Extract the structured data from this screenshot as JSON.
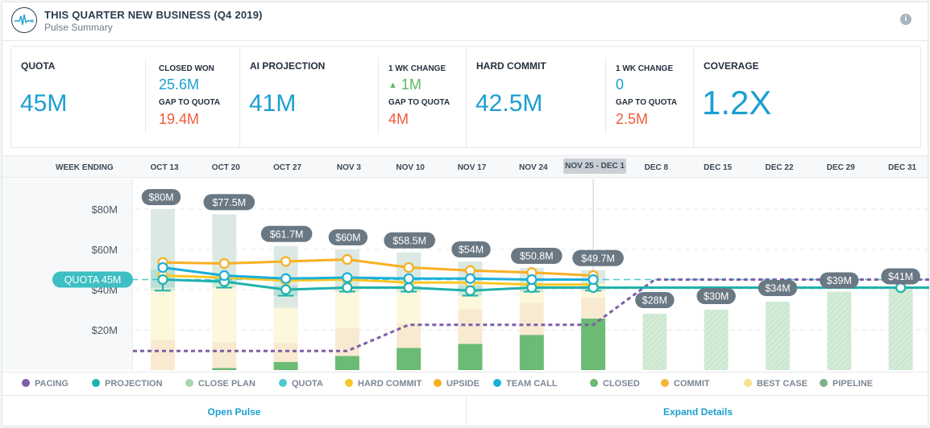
{
  "header": {
    "title": "THIS QUARTER NEW BUSINESS (Q4 2019)",
    "subtitle": "Pulse Summary",
    "logo_icon": "pulse-heartbeat-icon",
    "info_icon": "info-icon",
    "info_glyph": "i"
  },
  "kpis": {
    "quota": {
      "label": "QUOTA",
      "value": "45M"
    },
    "closed_won": {
      "label": "CLOSED WON",
      "value": "25.6M",
      "gap_label": "GAP TO QUOTA",
      "gap_value": "19.4M"
    },
    "ai_projection": {
      "label": "AI PROJECTION",
      "value": "41M"
    },
    "ai_change": {
      "label": "1 WK CHANGE",
      "arrow": "▲",
      "value": "1M",
      "gap_label": "GAP TO QUOTA",
      "gap_value": "4M"
    },
    "hard_commit": {
      "label": "HARD COMMIT",
      "value": "42.5M"
    },
    "hc_change": {
      "label": "1 WK CHANGE",
      "value": "0",
      "gap_label": "GAP TO QUOTA",
      "gap_value": "2.5M"
    },
    "coverage": {
      "label": "COVERAGE",
      "value": "1.2X"
    }
  },
  "weeks": {
    "label": "WEEK ENDING",
    "items": [
      "OCT 13",
      "OCT 20",
      "OCT 27",
      "NOV 3",
      "NOV 10",
      "NOV 17",
      "NOV 24",
      "NOV 25 - DEC 1",
      "DEC 8",
      "DEC 15",
      "DEC 22",
      "DEC 29",
      "DEC 31"
    ],
    "highlighted_index": 7
  },
  "legend": [
    {
      "label": "PACING",
      "color": "#7e5ea8"
    },
    {
      "label": "PROJECTION",
      "color": "#1fb1ad"
    },
    {
      "label": "CLOSE PLAN",
      "color": "#a8d8b0"
    },
    {
      "label": "QUOTA",
      "color": "#4fc9cf"
    },
    {
      "label": "HARD COMMIT",
      "color": "#f9c824"
    },
    {
      "label": "UPSIDE",
      "color": "#f7b023"
    },
    {
      "label": "TEAM CALL",
      "color": "#1ab0da"
    },
    {
      "label": "CLOSED",
      "color": "#6cbb75"
    },
    {
      "label": "COMMIT",
      "color": "#f5b43a"
    },
    {
      "label": "BEST CASE",
      "color": "#fbe08a"
    },
    {
      "label": "PIPELINE",
      "color": "#7faf8c"
    }
  ],
  "footer": {
    "open_pulse": "Open Pulse",
    "expand_details": "Expand Details"
  },
  "chart_data": {
    "type": "bar",
    "title": "",
    "xlabel": "WEEK ENDING",
    "ylabel": "",
    "ylim": [
      0,
      90
    ],
    "yticks": [
      {
        "value": 20,
        "label": "$20M"
      },
      {
        "value": 40,
        "label": "$40M"
      },
      {
        "value": 60,
        "label": "$60M"
      },
      {
        "value": 80,
        "label": "$80M"
      }
    ],
    "grid": true,
    "legend_position": "bottom",
    "categories": [
      "OCT 13",
      "OCT 20",
      "OCT 27",
      "NOV 3",
      "NOV 10",
      "NOV 17",
      "NOV 24",
      "NOV 25 - DEC 1",
      "DEC 8",
      "DEC 15",
      "DEC 22",
      "DEC 29",
      "DEC 31"
    ],
    "current_week_index": 7,
    "quota": {
      "value": 45,
      "label": "QUOTA 45M"
    },
    "totals": [
      80,
      77.5,
      61.7,
      60,
      58.5,
      54,
      50.8,
      49.7,
      null,
      null,
      null,
      null,
      null
    ],
    "total_labels": [
      "$80M",
      "$77.5M",
      "$61.7M",
      "$60M",
      "$58.5M",
      "$54M",
      "$50.8M",
      "$49.7M",
      null,
      null,
      null,
      null,
      null
    ],
    "stacked_series": [
      {
        "name": "CLOSED",
        "values": [
          0,
          1,
          4,
          7,
          11,
          13,
          17.5,
          25.6,
          null,
          null,
          null,
          null,
          null
        ]
      },
      {
        "name": "COMMIT",
        "values": [
          15,
          13,
          9.5,
          14,
          12,
          17,
          16,
          10.4,
          null,
          null,
          null,
          null,
          null
        ]
      },
      {
        "name": "BEST CASE",
        "values": [
          26,
          29,
          17.5,
          21,
          21,
          9,
          9,
          7,
          null,
          null,
          null,
          null,
          null
        ]
      },
      {
        "name": "PIPELINE",
        "values": [
          39,
          34.5,
          30.7,
          18,
          14.5,
          15,
          8.3,
          6.7,
          null,
          null,
          null,
          null,
          null
        ]
      }
    ],
    "close_plan": {
      "values": [
        null,
        null,
        null,
        null,
        null,
        null,
        null,
        null,
        28,
        30,
        34,
        39,
        41
      ],
      "labels": [
        null,
        null,
        null,
        null,
        null,
        null,
        null,
        null,
        "$28M",
        "$30M",
        "$34M",
        "$39M",
        "$41M"
      ]
    },
    "series": [
      {
        "name": "UPSIDE",
        "values": [
          53.5,
          53,
          54,
          55,
          51,
          49.5,
          48.5,
          47,
          null,
          null,
          null,
          null,
          null
        ]
      },
      {
        "name": "TEAM CALL",
        "values": [
          51,
          47,
          45.5,
          46,
          45.5,
          45.5,
          45,
          45,
          null,
          null,
          null,
          null,
          null
        ]
      },
      {
        "name": "HARD COMMIT",
        "values": [
          47,
          46,
          44.5,
          45,
          43.5,
          43.5,
          42.5,
          42.5,
          null,
          null,
          null,
          null,
          null
        ]
      },
      {
        "name": "PROJECTION",
        "values": [
          45,
          44,
          40,
          41,
          41,
          39.5,
          41,
          41,
          41,
          41,
          41,
          41,
          41
        ]
      },
      {
        "name": "PACING",
        "values": [
          9.5,
          9.5,
          9.5,
          9.5,
          22.5,
          22.5,
          22.5,
          22.5,
          45,
          45,
          45,
          45,
          45
        ]
      }
    ],
    "projection_error_low": [
      39.5,
      41,
      37,
      39,
      39,
      37,
      39,
      39.5,
      null,
      null,
      null,
      null,
      null
    ],
    "projection_error_high": [
      50,
      46,
      42,
      42,
      42,
      42,
      42,
      42,
      null,
      null,
      null,
      null,
      null
    ]
  }
}
